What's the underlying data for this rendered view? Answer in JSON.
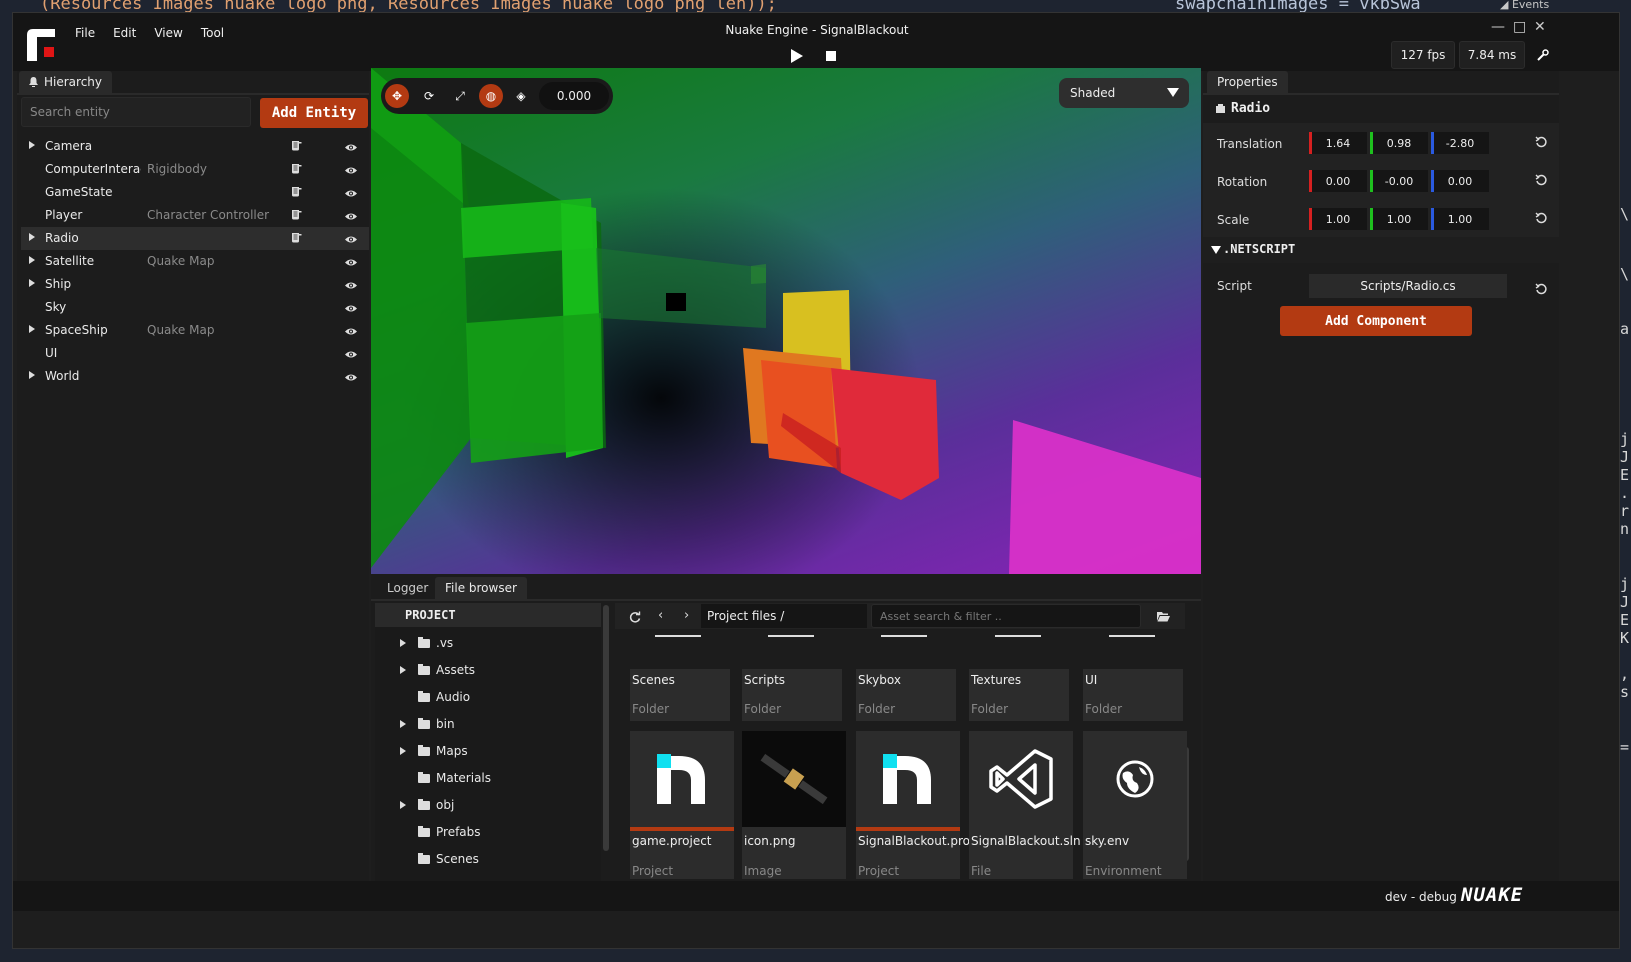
{
  "background": {
    "code_line_left": "(Resources_Images_nuake_logo_png, Resources_Images_nuake_logo_png_len));",
    "code_line_right": "swapchainImages = vkbSwa",
    "events_label": "Events",
    "right_edge_chars": [
      "\\",
      "\\",
      "a",
      "j",
      "J",
      "E",
      ".",
      "r",
      "n",
      "j",
      "J",
      "E",
      "K",
      ",",
      "s",
      "="
    ]
  },
  "titlebar": {
    "menu": [
      "File",
      "Edit",
      "View",
      "Tool"
    ],
    "title": "Nuake Engine - SignalBlackout",
    "fps": "127 fps",
    "frame_ms": "7.84 ms",
    "window_controls": [
      "—",
      "□",
      "✕"
    ]
  },
  "hierarchy": {
    "tab_label": "Hierarchy",
    "search_placeholder": "Search entity",
    "add_entity_label": "Add Entity",
    "entities": [
      {
        "name": "Camera",
        "component": "",
        "expandable": true,
        "has_script": true
      },
      {
        "name": "ComputerInteraction",
        "component": "Rigidbody",
        "expandable": false,
        "has_script": true
      },
      {
        "name": "GameState",
        "component": "",
        "expandable": false,
        "has_script": true
      },
      {
        "name": "Player",
        "component": "Character Controller",
        "expandable": false,
        "has_script": true
      },
      {
        "name": "Radio",
        "component": "",
        "expandable": true,
        "has_script": true
      },
      {
        "name": "Satellite",
        "component": "Quake Map",
        "expandable": true,
        "has_script": false
      },
      {
        "name": "Ship",
        "component": "",
        "expandable": true,
        "has_script": false
      },
      {
        "name": "Sky",
        "component": "",
        "expandable": false,
        "has_script": false
      },
      {
        "name": "SpaceShip",
        "component": "Quake Map",
        "expandable": true,
        "has_script": false
      },
      {
        "name": "UI",
        "component": "",
        "expandable": false,
        "has_script": false
      },
      {
        "name": "World",
        "component": "",
        "expandable": true,
        "has_script": false
      }
    ],
    "selected_index": 4
  },
  "viewport": {
    "snap_value": "0.000",
    "shading_mode": "Shaded"
  },
  "properties": {
    "tab_label": "Properties",
    "entity_name": "Radio",
    "transform": [
      {
        "label": "Translation",
        "x": "1.64",
        "y": "0.98",
        "z": "-2.80"
      },
      {
        "label": "Rotation",
        "x": "0.00",
        "y": "-0.00",
        "z": "0.00"
      },
      {
        "label": "Scale",
        "x": "1.00",
        "y": "1.00",
        "z": "1.00"
      }
    ],
    "netscript_header": ".NETSCRIPT",
    "script_label": "Script",
    "script_value": "Scripts/Radio.cs",
    "add_component_label": "Add Component"
  },
  "bottom": {
    "tabs": [
      "Logger",
      "File browser"
    ],
    "active_tab": 1,
    "project_header": "PROJECT",
    "tree": [
      {
        "label": ".vs",
        "expandable": true
      },
      {
        "label": "Assets",
        "expandable": true
      },
      {
        "label": "Audio",
        "expandable": false
      },
      {
        "label": "bin",
        "expandable": true
      },
      {
        "label": "Maps",
        "expandable": true
      },
      {
        "label": "Materials",
        "expandable": false
      },
      {
        "label": "obj",
        "expandable": true
      },
      {
        "label": "Prefabs",
        "expandable": false
      },
      {
        "label": "Scenes",
        "expandable": false
      }
    ],
    "path_label": "Project files",
    "path_sep": "/",
    "asset_search_placeholder": "Asset search & filter ..",
    "folders": [
      {
        "name": "Scenes",
        "type": "Folder"
      },
      {
        "name": "Scripts",
        "type": "Folder"
      },
      {
        "name": "Skybox",
        "type": "Folder"
      },
      {
        "name": "Textures",
        "type": "Folder"
      },
      {
        "name": "UI",
        "type": "Folder"
      }
    ],
    "assets": [
      {
        "name": "game.project",
        "type": "Project",
        "icon": "nuake-logo-icon",
        "accent": true
      },
      {
        "name": "icon.png",
        "type": "Image",
        "icon": "satellite-image",
        "accent": false
      },
      {
        "name": "SignalBlackout.project",
        "type": "Project",
        "icon": "nuake-logo-icon",
        "accent": true
      },
      {
        "name": "SignalBlackout.sln",
        "type": "File",
        "icon": "visual-studio-icon",
        "accent": false
      },
      {
        "name": "sky.env",
        "type": "Environment",
        "icon": "globe-icon",
        "accent": false
      }
    ]
  },
  "statusbar": {
    "build": "dev - debug",
    "brand": "NUAKE"
  },
  "colors": {
    "accent": "#b33a12",
    "panel": "#1c1c1c",
    "axis_x": "#d62020",
    "axis_y": "#1ec01e",
    "axis_z": "#2a5ae0"
  }
}
